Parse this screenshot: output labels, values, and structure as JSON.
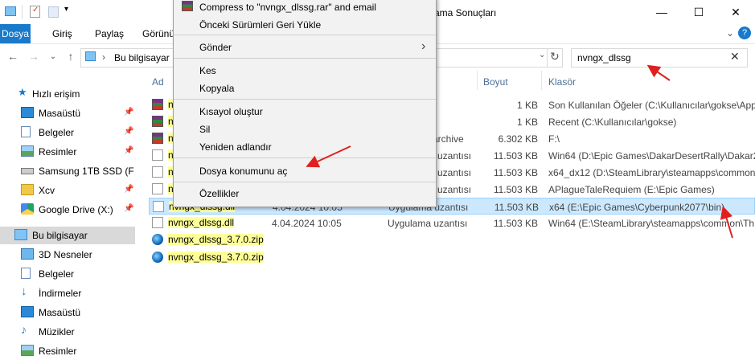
{
  "window": {
    "title": "ama Sonuçları",
    "minimize": "—",
    "maximize": "☐",
    "close": "✕",
    "help": "?"
  },
  "ribbon": {
    "tabs": [
      "Dosya",
      "Giriş",
      "Paylaş",
      "Görünü"
    ]
  },
  "address": {
    "path": "Bu bilgisayar İ",
    "refresh": "↻",
    "search_value": "nvngx_dlssg",
    "clear": "✕"
  },
  "nav": {
    "quick_access": "Hızlı erişim",
    "items": [
      {
        "label": "Masaüstü",
        "icon": "desktop-icon",
        "pinned": true
      },
      {
        "label": "Belgeler",
        "icon": "documents-icon",
        "pinned": true
      },
      {
        "label": "Resimler",
        "icon": "pictures-icon",
        "pinned": true
      },
      {
        "label": "Samsung 1TB SSD (F",
        "icon": "drive-icon",
        "pinned": true
      },
      {
        "label": "Xcv",
        "icon": "folder-icon",
        "pinned": true
      },
      {
        "label": "Google Drive (X:)",
        "icon": "google-drive-icon",
        "pinned": true
      }
    ],
    "this_pc": "Bu bilgisayar",
    "pc_items": [
      {
        "label": "3D Nesneler",
        "icon": "3d-objects-icon"
      },
      {
        "label": "Belgeler",
        "icon": "documents-icon"
      },
      {
        "label": "İndirmeler",
        "icon": "downloads-icon"
      },
      {
        "label": "Masaüstü",
        "icon": "desktop-icon"
      },
      {
        "label": "Müzikler",
        "icon": "music-icon"
      },
      {
        "label": "Resimler",
        "icon": "pictures-icon"
      }
    ]
  },
  "columns": {
    "name": "Ad",
    "size": "Boyut",
    "folder": "Klasör"
  },
  "files": [
    {
      "name": "n",
      "date": "",
      "type": "",
      "size": "1 KB",
      "folder": "Son Kullanılan Öğeler (C:\\Kullanıcılar\\gokse\\App",
      "icon": "rar"
    },
    {
      "name": "n",
      "date": "",
      "type": "",
      "size": "1 KB",
      "folder": "Recent (C:\\Kullanıcılar\\gokse)",
      "icon": "rar"
    },
    {
      "name": "n",
      "date": "",
      "type": "archive",
      "size": "6.302 KB",
      "folder": "F:\\",
      "icon": "rar"
    },
    {
      "name": "n",
      "date": "",
      "type": "uzantısı",
      "size": "11.503 KB",
      "folder": "Win64 (D:\\Epic Games\\DakarDesertRally\\Dakar2G",
      "icon": "dll"
    },
    {
      "name": "n",
      "date": "",
      "type": "uzantısı",
      "size": "11.503 KB",
      "folder": "x64_dx12 (D:\\SteamLibrary\\steamapps\\common\\",
      "icon": "dll"
    },
    {
      "name": "n",
      "date": "",
      "type": "uzantısı",
      "size": "11.503 KB",
      "folder": "APlagueTaleRequiem (E:\\Epic Games)",
      "icon": "dll"
    },
    {
      "name": "nvngx_dlssg.dll",
      "date": "4.04.2024 10:05",
      "type": "Uygulama uzantısı",
      "size": "11.503 KB",
      "folder": "x64 (E:\\Epic Games\\Cyberpunk2077\\bin)",
      "icon": "dll",
      "selected": true
    },
    {
      "name": "nvngx_dlssg.dll",
      "date": "4.04.2024 10:05",
      "type": "Uygulama uzantısı",
      "size": "11.503 KB",
      "folder": "Win64 (E:\\SteamLibrary\\steamapps\\common\\Th",
      "icon": "dll"
    },
    {
      "name": "nvngx_dlssg_3.7.0.zip",
      "date": "",
      "type": "",
      "size": "",
      "folder": "",
      "icon": "zip"
    },
    {
      "name": "nvngx_dlssg_3.7.0.zip",
      "date": "",
      "type": "",
      "size": "",
      "folder": "",
      "icon": "zip"
    }
  ],
  "context_menu": {
    "items": [
      "Compress to \"nvngx_dlssg.rar\" and email",
      "Önceki Sürümleri Geri Yükle",
      "Gönder",
      "Kes",
      "Kopyala",
      "Kısayol oluştur",
      "Sil",
      "Yeniden adlandır",
      "Dosya konumunu aç",
      "Özellikler"
    ],
    "submenu_arrow": "›"
  },
  "colors": {
    "accent": "#1979ca",
    "selection": "#cce8ff",
    "highlight": "#ffff99",
    "annotation_arrow": "#e02020"
  }
}
